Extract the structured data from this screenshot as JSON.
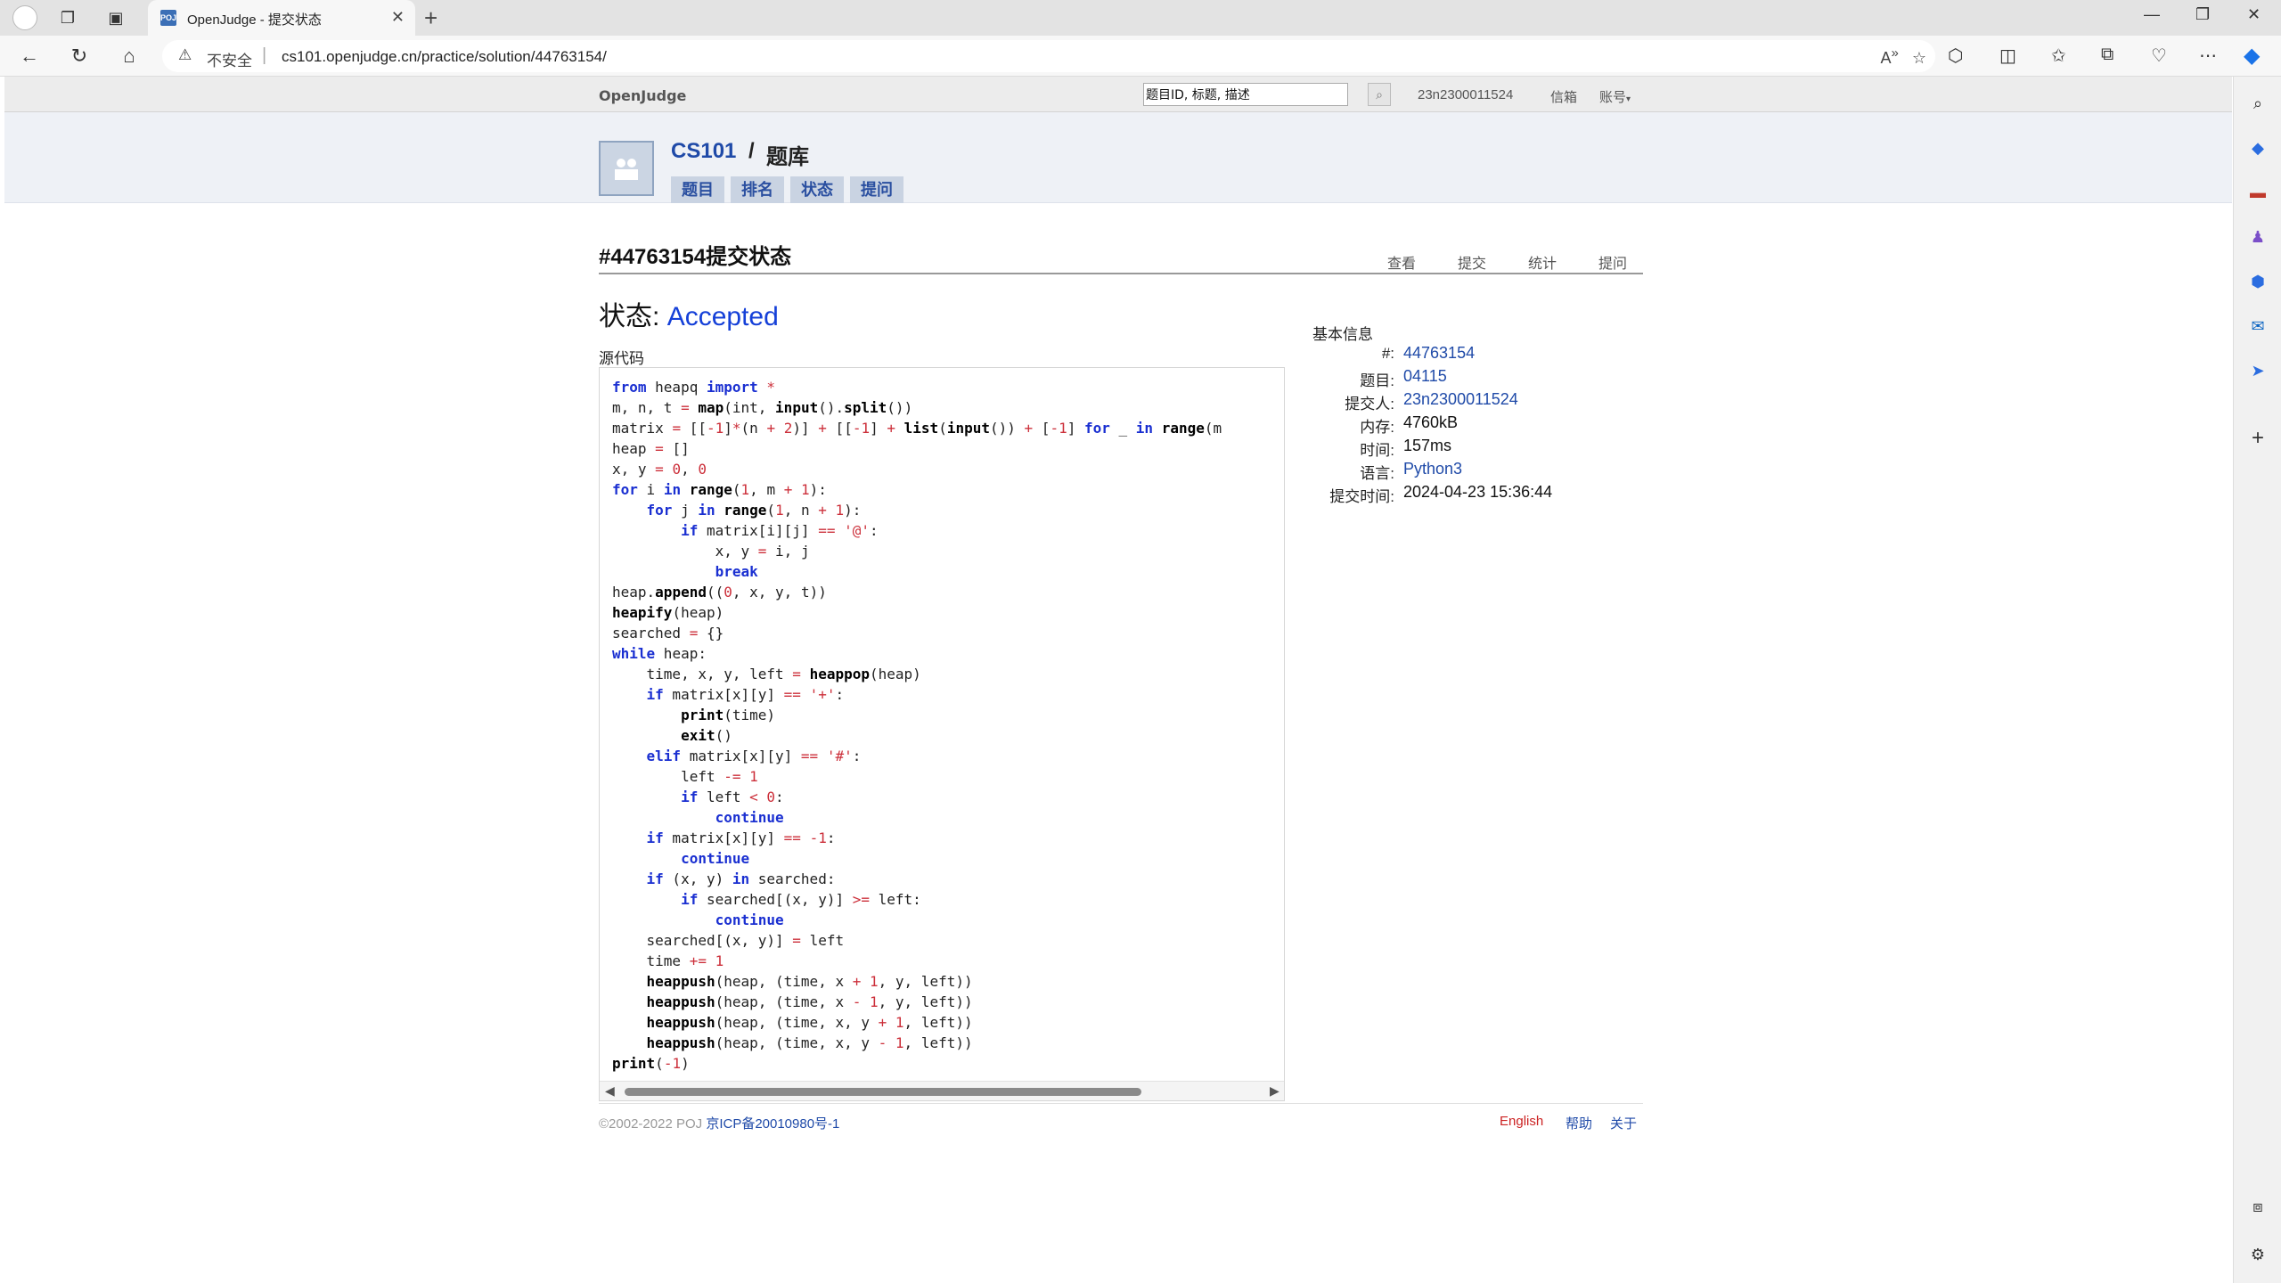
{
  "browser": {
    "tab_title": "OpenJudge - 提交状态",
    "tab_favicon": "POJ",
    "url_warning": "不安全",
    "url": "cs101.openjudge.cn/practice/solution/44763154/"
  },
  "topnav": {
    "brand": "OpenJudge",
    "search_placeholder": "题目ID, 标题, 描述",
    "user": "23n2300011524",
    "mail": "信箱",
    "account": "账号"
  },
  "group": {
    "name": "CS101",
    "slash": "/",
    "section": "题库",
    "tabs": [
      "题目",
      "排名",
      "状态",
      "提问"
    ]
  },
  "main": {
    "title": "#44763154提交状态",
    "subnav": [
      "查看",
      "提交",
      "统计",
      "提问"
    ],
    "status_label": "状态:",
    "status_value": "Accepted",
    "source_label": "源代码"
  },
  "code_lines": [
    "from heapq import *",
    "m, n, t = map(int, input().split())",
    "matrix = [[-1]*(n + 2)] + [[-1] + list(input()) + [-1] for _ in range(m",
    "heap = []",
    "x, y = 0, 0",
    "for i in range(1, m + 1):",
    "    for j in range(1, n + 1):",
    "        if matrix[i][j] == '@':",
    "            x, y = i, j",
    "            break",
    "heap.append((0, x, y, t))",
    "heapify(heap)",
    "searched = {}",
    "while heap:",
    "    time, x, y, left = heappop(heap)",
    "    if matrix[x][y] == '+':",
    "        print(time)",
    "        exit()",
    "    elif matrix[x][y] == '#':",
    "        left -= 1",
    "        if left < 0:",
    "            continue",
    "    if matrix[x][y] == -1:",
    "        continue",
    "    if (x, y) in searched:",
    "        if searched[(x, y)] >= left:",
    "            continue",
    "    searched[(x, y)] = left",
    "    time += 1",
    "    heappush(heap, (time, x + 1, y, left))",
    "    heappush(heap, (time, x - 1, y, left))",
    "    heappush(heap, (time, x, y + 1, left))",
    "    heappush(heap, (time, x, y - 1, left))",
    "print(-1)"
  ],
  "info": {
    "title": "基本信息",
    "rows": [
      {
        "label": "#:",
        "value": "44763154",
        "link": true
      },
      {
        "label": "题目:",
        "value": "04115",
        "link": true
      },
      {
        "label": "提交人:",
        "value": "23n2300011524",
        "link": true
      },
      {
        "label": "内存:",
        "value": "4760kB",
        "link": false
      },
      {
        "label": "时间:",
        "value": "157ms",
        "link": false
      },
      {
        "label": "语言:",
        "value": "Python3",
        "link": true
      },
      {
        "label": "提交时间:",
        "value": "2024-04-23 15:36:44",
        "link": false
      }
    ]
  },
  "footer": {
    "copyright": "©2002-2022 POJ",
    "icp": "京ICP备20010980号-1",
    "links": [
      "English",
      "帮助",
      "关于"
    ]
  },
  "colors": {
    "accent_link": "#1f4aa8",
    "accepted": "#1540d8",
    "keyword": "#1a2fd1",
    "literal": "#cc2f3a"
  }
}
